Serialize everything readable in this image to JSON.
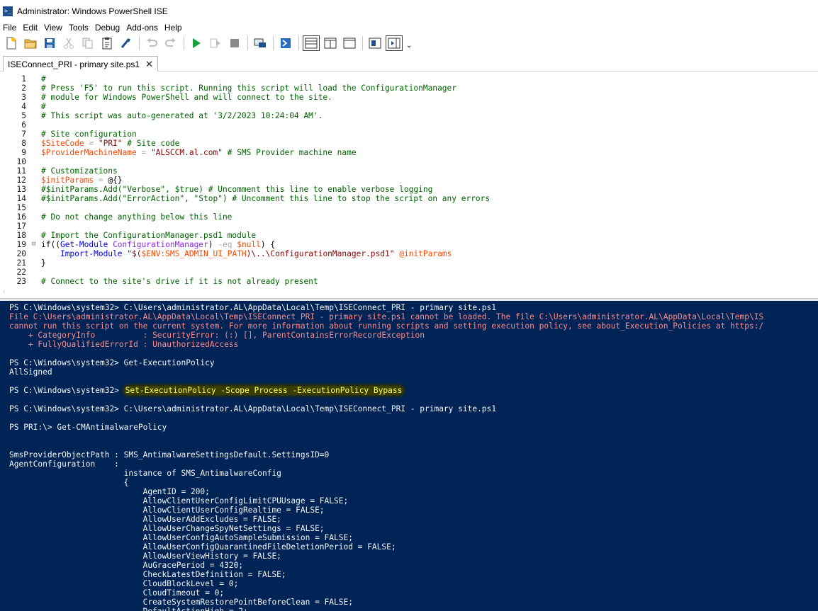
{
  "window": {
    "title": "Administrator: Windows PowerShell ISE"
  },
  "menu": [
    "File",
    "Edit",
    "View",
    "Tools",
    "Debug",
    "Add-ons",
    "Help"
  ],
  "toolbar": {
    "buttons": [
      {
        "name": "new-script-icon"
      },
      {
        "name": "open-folder-icon"
      },
      {
        "name": "save-icon"
      },
      {
        "name": "cut-icon"
      },
      {
        "name": "copy-icon"
      },
      {
        "name": "paste-icon"
      },
      {
        "name": "clear-console-icon"
      },
      {
        "name": "undo-icon"
      },
      {
        "name": "redo-icon"
      },
      {
        "name": "run-script-icon"
      },
      {
        "name": "run-selection-icon"
      },
      {
        "name": "stop-icon"
      },
      {
        "name": "new-remote-tab-icon"
      },
      {
        "name": "start-powershell-icon"
      },
      {
        "name": "show-script-top-icon"
      },
      {
        "name": "show-script-right-icon"
      },
      {
        "name": "show-script-max-icon"
      },
      {
        "name": "show-commands-icon"
      },
      {
        "name": "show-addon-icon"
      }
    ],
    "overflow_label": "⌄"
  },
  "tab": {
    "label": "ISEConnect_PRI - primary site.ps1",
    "close_glyph": "✕"
  },
  "editor": {
    "lines": [
      {
        "n": "1",
        "fold": "",
        "tokens": [
          [
            "c",
            "#"
          ]
        ]
      },
      {
        "n": "2",
        "fold": "",
        "tokens": [
          [
            "c",
            "# Press 'F5' to run this script. Running this script will load the ConfigurationManager"
          ]
        ]
      },
      {
        "n": "3",
        "fold": "",
        "tokens": [
          [
            "c",
            "# module for Windows PowerShell and will connect to the site."
          ]
        ]
      },
      {
        "n": "4",
        "fold": "",
        "tokens": [
          [
            "c",
            "#"
          ]
        ]
      },
      {
        "n": "5",
        "fold": "",
        "tokens": [
          [
            "c",
            "# This script was auto-generated at '3/2/2023 10:24:04 AM'."
          ]
        ]
      },
      {
        "n": "6",
        "fold": "",
        "tokens": []
      },
      {
        "n": "7",
        "fold": "",
        "tokens": [
          [
            "c",
            "# Site configuration"
          ]
        ]
      },
      {
        "n": "8",
        "fold": "",
        "tokens": [
          [
            "v",
            "$SiteCode"
          ],
          [
            "o",
            " = "
          ],
          [
            "s",
            "\"PRI\""
          ],
          [
            "c",
            " # Site code"
          ]
        ]
      },
      {
        "n": "9",
        "fold": "",
        "tokens": [
          [
            "v",
            "$ProviderMachineName"
          ],
          [
            "o",
            " = "
          ],
          [
            "s",
            "\"ALSCCM.al.com\""
          ],
          [
            "c",
            " # SMS Provider machine name"
          ]
        ]
      },
      {
        "n": "10",
        "fold": "",
        "tokens": []
      },
      {
        "n": "11",
        "fold": "",
        "tokens": [
          [
            "c",
            "# Customizations"
          ]
        ]
      },
      {
        "n": "12",
        "fold": "",
        "tokens": [
          [
            "v",
            "$initParams"
          ],
          [
            "o",
            " = "
          ],
          [
            "p",
            "@{}"
          ]
        ]
      },
      {
        "n": "13",
        "fold": "",
        "tokens": [
          [
            "c",
            "#$initParams.Add(\"Verbose\", $true) # Uncomment this line to enable verbose logging"
          ]
        ]
      },
      {
        "n": "14",
        "fold": "",
        "tokens": [
          [
            "c",
            "#$initParams.Add(\"ErrorAction\", \"Stop\") # Uncomment this line to stop the script on any errors"
          ]
        ]
      },
      {
        "n": "15",
        "fold": "",
        "tokens": []
      },
      {
        "n": "16",
        "fold": "",
        "tokens": [
          [
            "c",
            "# Do not change anything below this line"
          ]
        ]
      },
      {
        "n": "17",
        "fold": "",
        "tokens": []
      },
      {
        "n": "18",
        "fold": "",
        "tokens": [
          [
            "c",
            "# Import the ConfigurationManager.psd1 module"
          ]
        ]
      },
      {
        "n": "19",
        "fold": "⊟",
        "tokens": [
          [
            "k",
            "if"
          ],
          [
            "p",
            "(("
          ],
          [
            "m",
            "Get-Module"
          ],
          [
            "t",
            " ConfigurationManager"
          ],
          [
            "p",
            ") "
          ],
          [
            "o",
            "-eq"
          ],
          [
            "p",
            " "
          ],
          [
            "v",
            "$null"
          ],
          [
            "p",
            ") {"
          ]
        ]
      },
      {
        "n": "20",
        "fold": "",
        "tokens": [
          [
            "p",
            "    "
          ],
          [
            "m",
            "Import-Module"
          ],
          [
            "p",
            " "
          ],
          [
            "s",
            "\"$("
          ],
          [
            "v",
            "$ENV:SMS_ADMIN_UI_PATH"
          ],
          [
            "s",
            ")\\..\\ConfigurationManager.psd1\""
          ],
          [
            "p",
            " "
          ],
          [
            "v",
            "@initParams"
          ]
        ]
      },
      {
        "n": "21",
        "fold": "",
        "tokens": [
          [
            "p",
            "}"
          ]
        ]
      },
      {
        "n": "22",
        "fold": "",
        "tokens": []
      },
      {
        "n": "23",
        "fold": "",
        "tokens": [
          [
            "c",
            "# Connect to the site's drive if it is not already present"
          ]
        ]
      }
    ]
  },
  "console": {
    "lines": [
      {
        "kind": "out",
        "text": "PS C:\\Windows\\system32> C:\\Users\\administrator.AL\\AppData\\Local\\Temp\\ISEConnect_PRI - primary site.ps1"
      },
      {
        "kind": "err",
        "text": "File C:\\Users\\administrator.AL\\AppData\\Local\\Temp\\ISEConnect_PRI - primary site.ps1 cannot be loaded. The file C:\\Users\\administrator.AL\\AppData\\Local\\Temp\\IS"
      },
      {
        "kind": "err",
        "text": "cannot run this script on the current system. For more information about running scripts and setting execution policy, see about_Execution_Policies at https:/"
      },
      {
        "kind": "err",
        "text": "    + CategoryInfo          : SecurityError: (:) [], ParentContainsErrorRecordException"
      },
      {
        "kind": "err",
        "text": "    + FullyQualifiedErrorId : UnauthorizedAccess"
      },
      {
        "kind": "blank",
        "text": ""
      },
      {
        "kind": "out",
        "text": "PS C:\\Windows\\system32> Get-ExecutionPolicy"
      },
      {
        "kind": "out",
        "text": "AllSigned"
      },
      {
        "kind": "blank",
        "text": ""
      },
      {
        "kind": "hl",
        "prompt": "PS C:\\Windows\\system32> ",
        "text": "Set-ExecutionPolicy -Scope Process -ExecutionPolicy Bypass"
      },
      {
        "kind": "blank",
        "text": ""
      },
      {
        "kind": "out",
        "text": "PS C:\\Windows\\system32> C:\\Users\\administrator.AL\\AppData\\Local\\Temp\\ISEConnect_PRI - primary site.ps1"
      },
      {
        "kind": "blank",
        "text": ""
      },
      {
        "kind": "out",
        "text": "PS PRI:\\> Get-CMAntimalwarePolicy"
      },
      {
        "kind": "blank",
        "text": ""
      },
      {
        "kind": "blank",
        "text": ""
      },
      {
        "kind": "out",
        "text": "SmsProviderObjectPath : SMS_AntimalwareSettingsDefault.SettingsID=0"
      },
      {
        "kind": "out",
        "text": "AgentConfiguration    :"
      },
      {
        "kind": "out",
        "text": "                        instance of SMS_AntimalwareConfig"
      },
      {
        "kind": "out",
        "text": "                        {"
      },
      {
        "kind": "out",
        "text": "                            AgentID = 200;"
      },
      {
        "kind": "out",
        "text": "                            AllowClientUserConfigLimitCPUUsage = FALSE;"
      },
      {
        "kind": "out",
        "text": "                            AllowClientUserConfigRealtime = FALSE;"
      },
      {
        "kind": "out",
        "text": "                            AllowUserAddExcludes = FALSE;"
      },
      {
        "kind": "out",
        "text": "                            AllowUserChangeSpyNetSettings = FALSE;"
      },
      {
        "kind": "out",
        "text": "                            AllowUserConfigAutoSampleSubmission = FALSE;"
      },
      {
        "kind": "out",
        "text": "                            AllowUserConfigQuarantinedFileDeletionPeriod = FALSE;"
      },
      {
        "kind": "out",
        "text": "                            AllowUserViewHistory = FALSE;"
      },
      {
        "kind": "out",
        "text": "                            AuGracePeriod = 4320;"
      },
      {
        "kind": "out",
        "text": "                            CheckLatestDefinition = FALSE;"
      },
      {
        "kind": "out",
        "text": "                            CloudBlockLevel = 0;"
      },
      {
        "kind": "out",
        "text": "                            CloudTimeout = 0;"
      },
      {
        "kind": "out",
        "text": "                            CreateSystemRestorePointBeforeClean = FALSE;"
      },
      {
        "kind": "out",
        "text": "                            DefaultActionHigh = 2;"
      }
    ]
  },
  "colors": {
    "console_bg": "#012456",
    "console_fg": "#f5f5f5",
    "console_error": "#ff8a8a",
    "highlight": "#ffff5c",
    "comment": "#006400",
    "variable": "#ff4500",
    "string": "#8b0000",
    "cmdlet": "#0000ff"
  }
}
